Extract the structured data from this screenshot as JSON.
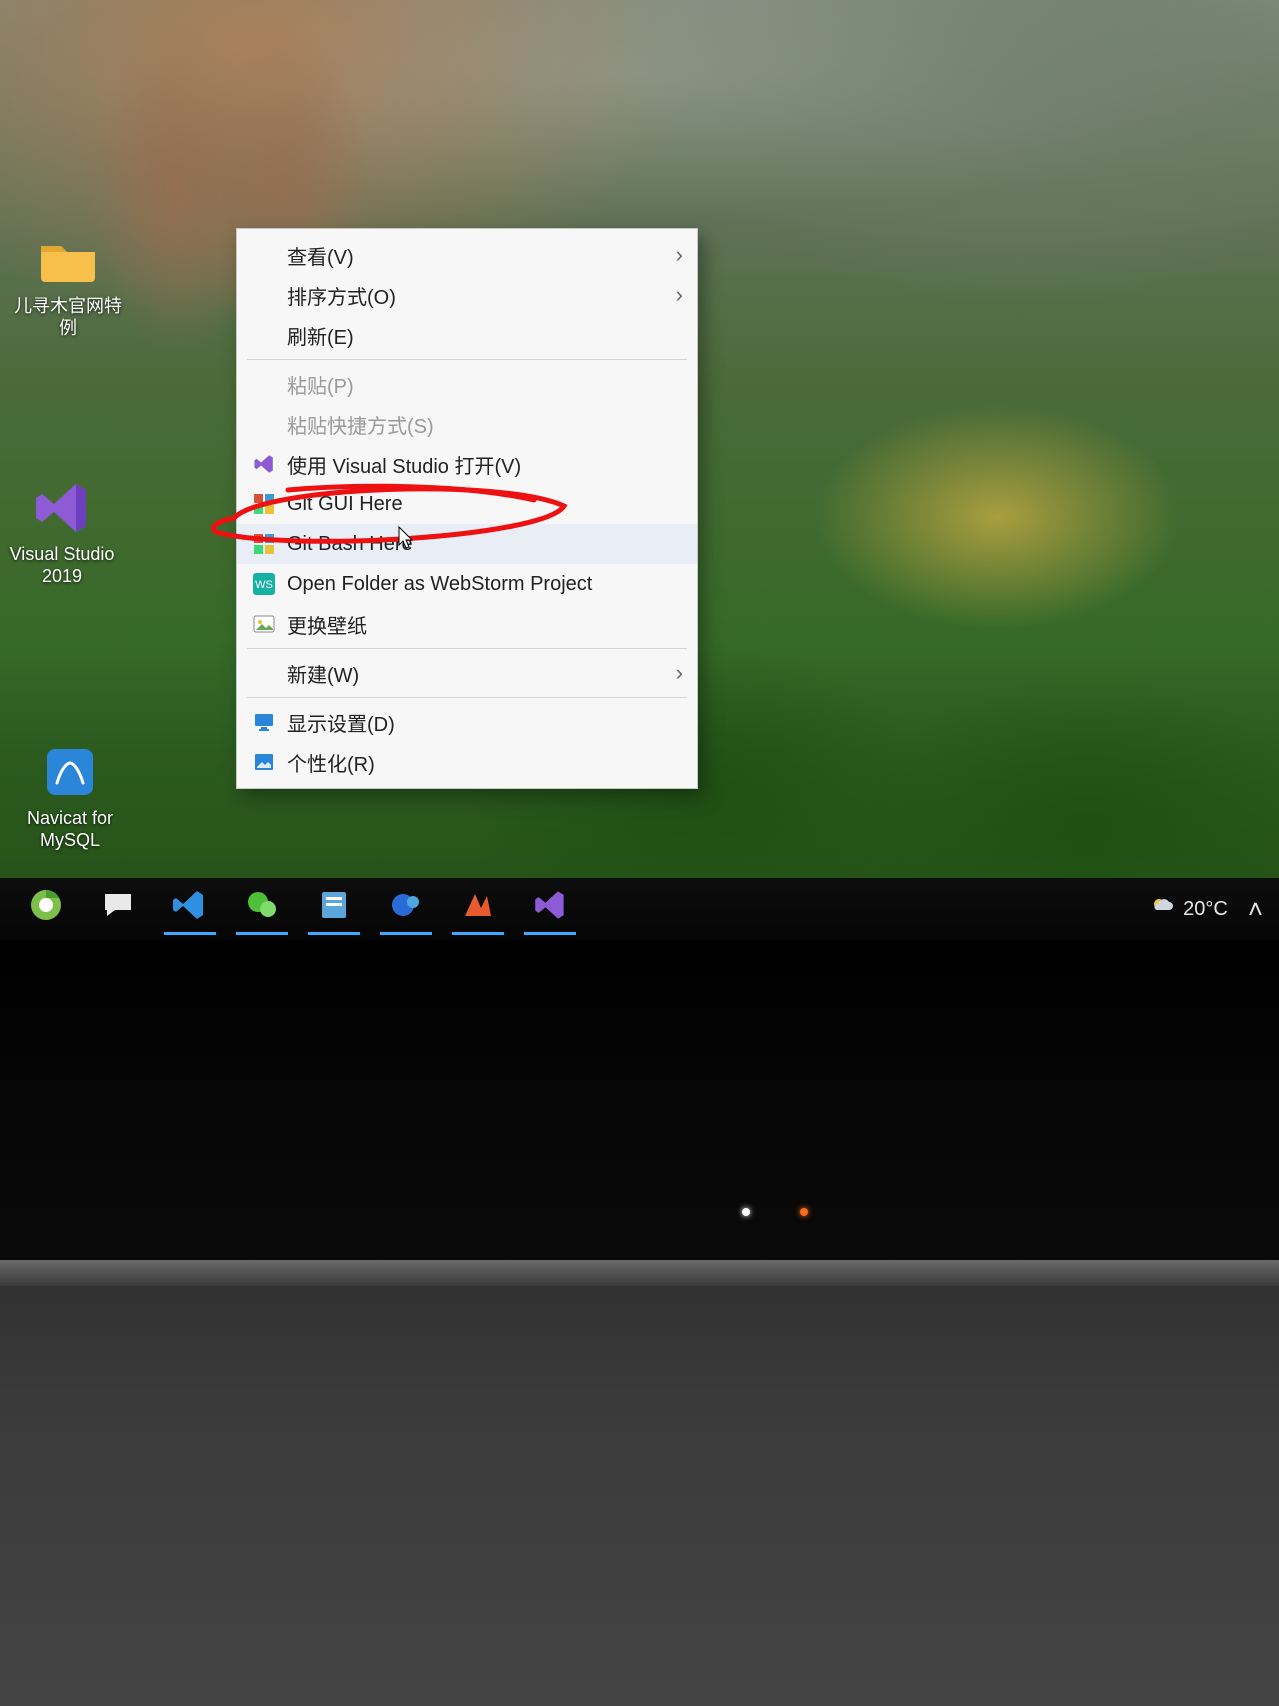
{
  "desktop_icons": {
    "folder1": {
      "label": "儿寻木官网特例"
    },
    "vs2019": {
      "label": "Visual Studio 2019"
    },
    "navicat": {
      "label": "Navicat for MySQL"
    }
  },
  "context_menu": {
    "groups": [
      [
        {
          "key": "view",
          "label": "查看(V)",
          "arrow": true,
          "icon": "none",
          "disabled": false
        },
        {
          "key": "sort",
          "label": "排序方式(O)",
          "arrow": true,
          "icon": "none",
          "disabled": false
        },
        {
          "key": "refresh",
          "label": "刷新(E)",
          "arrow": false,
          "icon": "none",
          "disabled": false
        }
      ],
      [
        {
          "key": "paste",
          "label": "粘贴(P)",
          "arrow": false,
          "icon": "none",
          "disabled": true
        },
        {
          "key": "paste_short",
          "label": "粘贴快捷方式(S)",
          "arrow": false,
          "icon": "none",
          "disabled": true
        },
        {
          "key": "open_vs",
          "label": "使用 Visual Studio 打开(V)",
          "arrow": false,
          "icon": "vs",
          "disabled": false
        },
        {
          "key": "git_gui",
          "label": "Git GUI Here",
          "arrow": false,
          "icon": "git",
          "disabled": false
        },
        {
          "key": "git_bash",
          "label": "Git Bash Here",
          "arrow": false,
          "icon": "git",
          "disabled": false,
          "hover": true
        },
        {
          "key": "webstorm",
          "label": "Open Folder as WebStorm Project",
          "arrow": false,
          "icon": "webstorm",
          "disabled": false
        },
        {
          "key": "wallpaper",
          "label": "更换壁纸",
          "arrow": false,
          "icon": "wallpaper",
          "disabled": false
        }
      ],
      [
        {
          "key": "new",
          "label": "新建(W)",
          "arrow": true,
          "icon": "none",
          "disabled": false
        }
      ],
      [
        {
          "key": "display",
          "label": "显示设置(D)",
          "arrow": false,
          "icon": "monitor",
          "disabled": false
        },
        {
          "key": "personalize",
          "label": "个性化(R)",
          "arrow": false,
          "icon": "picture",
          "disabled": false
        }
      ]
    ]
  },
  "taskbar": {
    "icons": [
      {
        "key": "browser",
        "icon": "browser",
        "running": false
      },
      {
        "key": "chat",
        "icon": "chat",
        "running": false
      },
      {
        "key": "vscode",
        "icon": "vscode",
        "running": true
      },
      {
        "key": "wechat",
        "icon": "wechat",
        "running": true
      },
      {
        "key": "notes",
        "icon": "notes",
        "running": true
      },
      {
        "key": "teams",
        "icon": "teams",
        "running": true
      },
      {
        "key": "wps",
        "icon": "wps",
        "running": true
      },
      {
        "key": "vs",
        "icon": "vs",
        "running": true
      }
    ],
    "weather_temp": "20°C"
  }
}
